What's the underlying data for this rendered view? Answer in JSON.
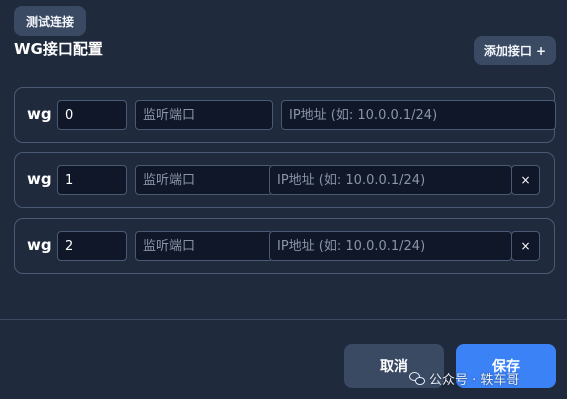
{
  "header": {
    "test_button": "测试连接",
    "title": "WG接口配置",
    "add_button": "添加接口 +"
  },
  "interfaces": [
    {
      "prefix": "wg",
      "name": "0",
      "port_placeholder": "监听端口",
      "ip_placeholder": "IP地址 (如: 10.0.0.1/24)",
      "deletable": false
    },
    {
      "prefix": "wg",
      "name": "1",
      "port_placeholder": "监听端口",
      "ip_placeholder": "IP地址 (如: 10.0.0.1/24)",
      "deletable": true
    },
    {
      "prefix": "wg",
      "name": "2",
      "port_placeholder": "监听端口",
      "ip_placeholder": "IP地址 (如: 10.0.0.1/24)",
      "deletable": true
    }
  ],
  "delete_label": "×",
  "footer": {
    "cancel": "取消",
    "save": "保存"
  },
  "watermark": {
    "icon": "wechat-icon",
    "text": "公众号 · 轶车哥"
  },
  "colors": {
    "background": "#1f2a3d",
    "input_bg": "#0f1729",
    "border": "#4a5a74",
    "secondary_button": "#3a4a63",
    "primary_button": "#3b82f6"
  }
}
